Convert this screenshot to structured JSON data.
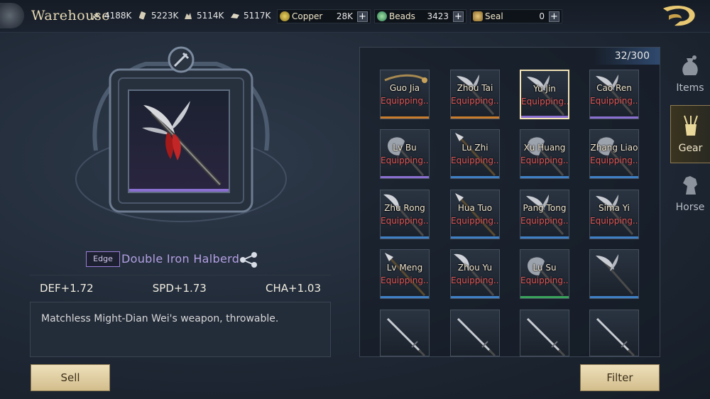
{
  "header": {
    "title": "Warehouse",
    "resources": [
      {
        "icon": "grain-icon",
        "value": "4188K"
      },
      {
        "icon": "wood-icon",
        "value": "5223K"
      },
      {
        "icon": "stone-icon",
        "value": "5114K"
      },
      {
        "icon": "iron-icon",
        "value": "5117K"
      }
    ],
    "currencies": [
      {
        "icon": "copper-coin-icon",
        "label": "Copper",
        "value": "28K",
        "add": "+"
      },
      {
        "icon": "beads-icon",
        "label": "Beads",
        "value": "3423",
        "add": "+"
      },
      {
        "icon": "seal-icon",
        "label": "Seal",
        "value": "0",
        "add": "+"
      }
    ],
    "logo_icon": "dragon-logo-icon"
  },
  "item": {
    "quality_badge": "Edge",
    "name": "Double Iron Halberd",
    "stats": [
      "DEF+1.72",
      "SPD+1.73",
      "CHA+1.03"
    ],
    "description": "Matchless Might-Dian Wei's weapon, throwable.",
    "quality_color": "#8a6fd0"
  },
  "buttons": {
    "sell": "Sell",
    "filter": "Filter"
  },
  "inventory": {
    "count": "32/300",
    "slots": [
      {
        "owner": "Guo Jia",
        "status": "Equipping...",
        "bar": "#c97c2b",
        "weapon": "staff-icon",
        "selected": false
      },
      {
        "owner": "Zhou Tai",
        "status": "Equipping...",
        "bar": "#c97c2b",
        "weapon": "halberd-icon",
        "selected": false
      },
      {
        "owner": "Yu Jin",
        "status": "Equipping...",
        "bar": "#8a6fd0",
        "weapon": "halberd-icon",
        "selected": true
      },
      {
        "owner": "Cao Ren",
        "status": "Equipping...",
        "bar": "#8a6fd0",
        "weapon": "halberd-icon",
        "selected": false
      },
      {
        "owner": "Lv Bu",
        "status": "Equipping...",
        "bar": "#8a6fd0",
        "weapon": "axe-icon",
        "selected": false
      },
      {
        "owner": "Lu Zhi",
        "status": "Equipping...",
        "bar": "#3f7fc4",
        "weapon": "spear-icon",
        "selected": false
      },
      {
        "owner": "Xu Huang",
        "status": "Equipping...",
        "bar": "#3f7fc4",
        "weapon": "axe-icon",
        "selected": false
      },
      {
        "owner": "Zhang Liao",
        "status": "Equipping...",
        "bar": "#3f7fc4",
        "weapon": "axe-icon",
        "selected": false
      },
      {
        "owner": "Zhu Rong",
        "status": "Equipping...",
        "bar": "#3f7fc4",
        "weapon": "glaive-icon",
        "selected": false
      },
      {
        "owner": "Hua Tuo",
        "status": "Equipping...",
        "bar": "#3f7fc4",
        "weapon": "spear-icon",
        "selected": false
      },
      {
        "owner": "Pang Tong",
        "status": "Equipping...",
        "bar": "#3f7fc4",
        "weapon": "halberd-icon",
        "selected": false
      },
      {
        "owner": "Sima Yi",
        "status": "Equipping...",
        "bar": "#3f7fc4",
        "weapon": "halberd-icon",
        "selected": false
      },
      {
        "owner": "Lv Meng",
        "status": "Equipping...",
        "bar": "#3f7fc4",
        "weapon": "spear-icon",
        "selected": false
      },
      {
        "owner": "Zhou Yu",
        "status": "Equipping...",
        "bar": "#3f7fc4",
        "weapon": "glaive-icon",
        "selected": false
      },
      {
        "owner": "Lu Su",
        "status": "Equipping...",
        "bar": "#3aa35a",
        "weapon": "axe-icon",
        "selected": false
      },
      {
        "owner": "",
        "status": "",
        "bar": "#3f7fc4",
        "weapon": "halberd-icon",
        "selected": false
      },
      {
        "owner": "",
        "status": "",
        "bar": "",
        "weapon": "sword-icon",
        "selected": false
      },
      {
        "owner": "",
        "status": "",
        "bar": "",
        "weapon": "sword-icon",
        "selected": false
      },
      {
        "owner": "",
        "status": "",
        "bar": "",
        "weapon": "sword-icon",
        "selected": false
      },
      {
        "owner": "",
        "status": "",
        "bar": "",
        "weapon": "sword-icon",
        "selected": false
      }
    ]
  },
  "side_tabs": [
    {
      "label": "Items",
      "icon": "pouch-icon",
      "active": false
    },
    {
      "label": "Gear",
      "icon": "weapon-rack-icon",
      "active": true
    },
    {
      "label": "Horse",
      "icon": "horse-icon",
      "active": false
    }
  ]
}
